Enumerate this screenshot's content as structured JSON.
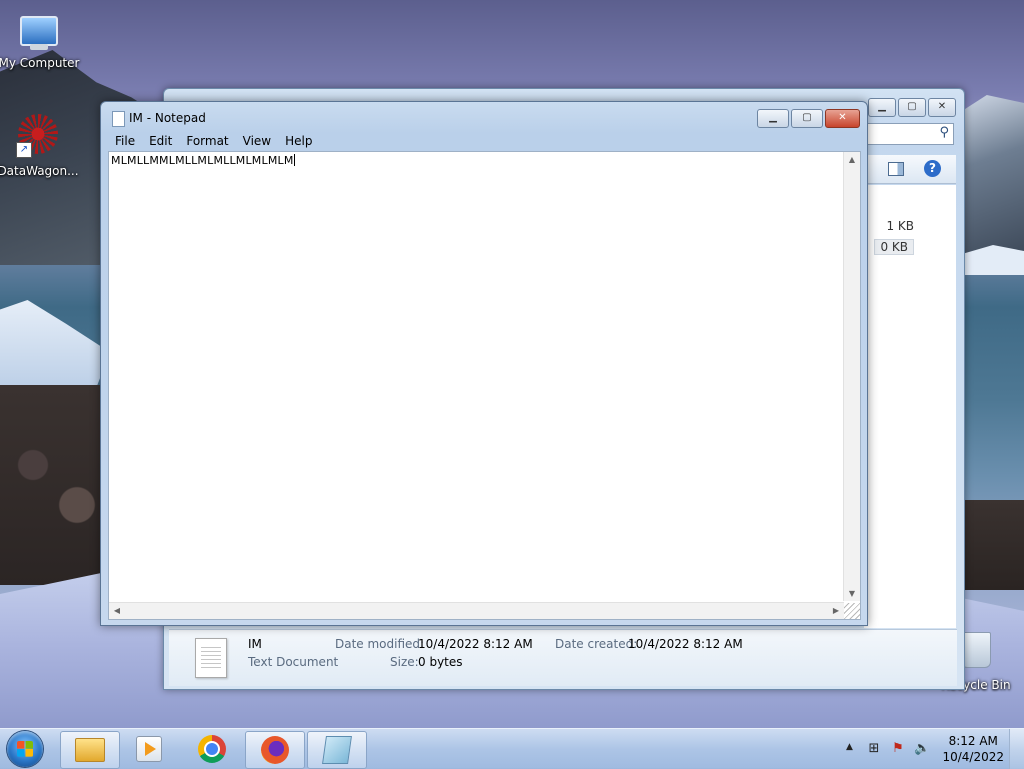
{
  "desktop": {
    "icons": [
      {
        "label": "My Computer"
      },
      {
        "label": "DataWagon..."
      },
      {
        "label": "Recycle Bin"
      }
    ]
  },
  "explorer": {
    "sizes": [
      "1 KB",
      "0 KB"
    ],
    "details": {
      "name": "IM",
      "type": "Text Document",
      "date_modified_label": "Date modified:",
      "date_modified": "10/4/2022 8:12 AM",
      "date_created_label": "Date created:",
      "date_created": "10/4/2022 8:12 AM",
      "size_label": "Size:",
      "size": "0 bytes"
    }
  },
  "notepad": {
    "title": "IM - Notepad",
    "menu": [
      "File",
      "Edit",
      "Format",
      "View",
      "Help"
    ],
    "content": "MLMLLMMLMLLMLMLLMLMLMLM"
  },
  "taskbar": {
    "clock_time": "8:12 AM",
    "clock_date": "10/4/2022"
  },
  "icons": {
    "start": "windows-start-orb",
    "explorer": "folder-icon",
    "media": "media-player-icon",
    "chrome": "chrome-icon",
    "firefox": "firefox-icon",
    "notepad": "notepad-icon"
  }
}
